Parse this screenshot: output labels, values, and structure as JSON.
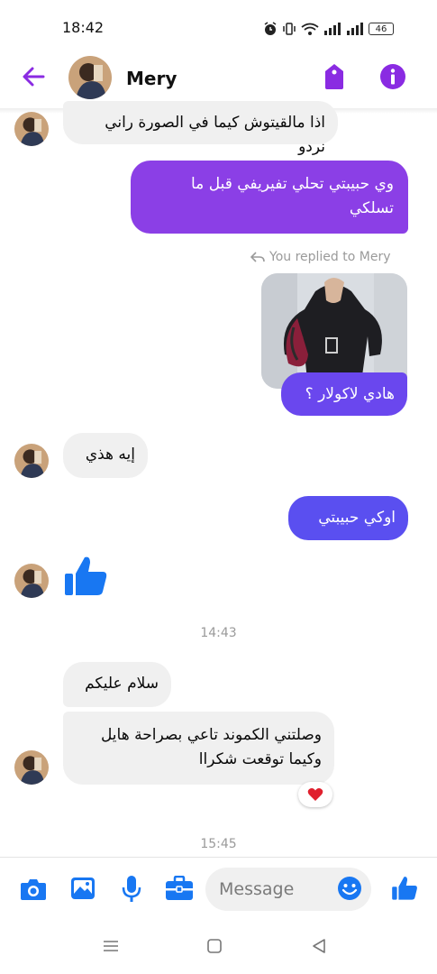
{
  "status_bar": {
    "time": "18:42",
    "battery": "46"
  },
  "header": {
    "contact_name": "Mery",
    "accent": "#8a2be2"
  },
  "replied_label": "You replied to Mery",
  "messages": [
    {
      "from": "them",
      "text": "اذا مالقيتوش كيما في الصورة راني نردو"
    },
    {
      "from": "me",
      "line1": "وي حبيبتي تحلي تفيريفي قبل ما",
      "line2": "تسلكي"
    },
    {
      "from": "me",
      "text": "هادي لاكولار ؟"
    },
    {
      "from": "them",
      "text": "إيه هذي"
    },
    {
      "from": "me",
      "text": "اوكي حبيبتي"
    },
    {
      "from": "them",
      "type": "like"
    },
    {
      "from": "them",
      "text": "سلام عليكم"
    },
    {
      "from": "them",
      "line1": "وصلتني الكموند تاعي بصراحة هايل",
      "line2": "وكيما توقعت شكراا",
      "reaction": "heart"
    }
  ],
  "timestamps": {
    "t1": "14:43",
    "t2": "15:45"
  },
  "composer": {
    "placeholder": "Message",
    "icons": [
      "camera-icon",
      "image-icon",
      "microphone-icon",
      "briefcase-icon",
      "emoji-icon",
      "like-icon"
    ],
    "icon_color": "#1877f2"
  },
  "colors": {
    "out_purple": "#8b3fe6",
    "out_blue": "#5a4ff0",
    "incoming_bg": "#f0f0f0"
  }
}
